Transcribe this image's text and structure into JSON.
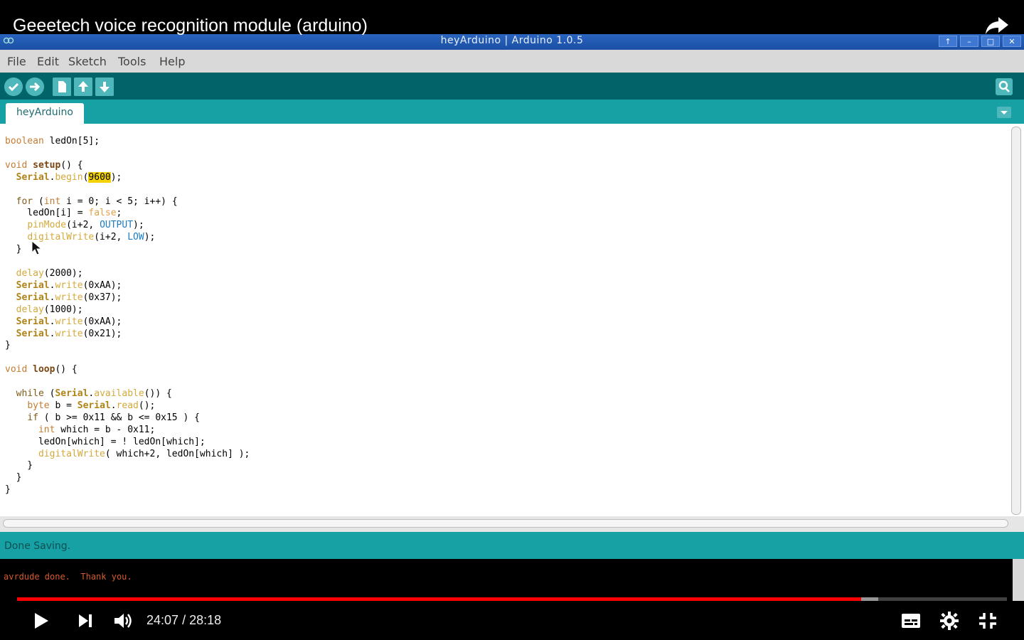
{
  "video": {
    "title": "Geeetech voice recognition module (arduino)",
    "current_time": "24:07",
    "time_separator": "/",
    "duration": "28:18",
    "progress_fraction": 0.853,
    "buffered_fraction": 0.87
  },
  "window": {
    "title": "heyArduino | Arduino 1.0.5",
    "buttons": [
      "up",
      "minimize",
      "maximize",
      "close"
    ]
  },
  "menu": [
    "File",
    "Edit",
    "Sketch",
    "Tools",
    "Help"
  ],
  "toolbar": {
    "buttons": [
      "verify",
      "upload",
      "new",
      "open",
      "save"
    ],
    "right_button": "serial-monitor"
  },
  "tab": {
    "label": "heyArduino"
  },
  "code": [
    "boolean ledOn[5];",
    "",
    "void setup() {",
    "  Serial.begin(9600);",
    "",
    "  for (int i = 0; i < 5; i++) {",
    "    ledOn[i] = false;",
    "    pinMode(i+2, OUTPUT);",
    "    digitalWrite(i+2, LOW);",
    "  }",
    "",
    "  delay(2000);",
    "  Serial.write(0xAA);",
    "  Serial.write(0x37);",
    "  delay(1000);",
    "  Serial.write(0xAA);",
    "  Serial.write(0x21);",
    "}",
    "",
    "void loop() {",
    "",
    "  while (Serial.available()) {",
    "    byte b = Serial.read();",
    "    if ( b >= 0x11 && b <= 0x15 ) {",
    "      int which = b - 0x11;",
    "      ledOn[which] = ! ledOn[which];",
    "      digitalWrite( which+2, ledOn[which] );",
    "    }",
    "  }",
    "}"
  ],
  "status": {
    "text": "Done Saving."
  },
  "console": {
    "text": "avrdude done.  Thank you."
  },
  "colors": {
    "toolbar": "#006468",
    "tabbar": "#17a1a5",
    "progress": "#ff0000",
    "highlight": "#f3d200"
  }
}
